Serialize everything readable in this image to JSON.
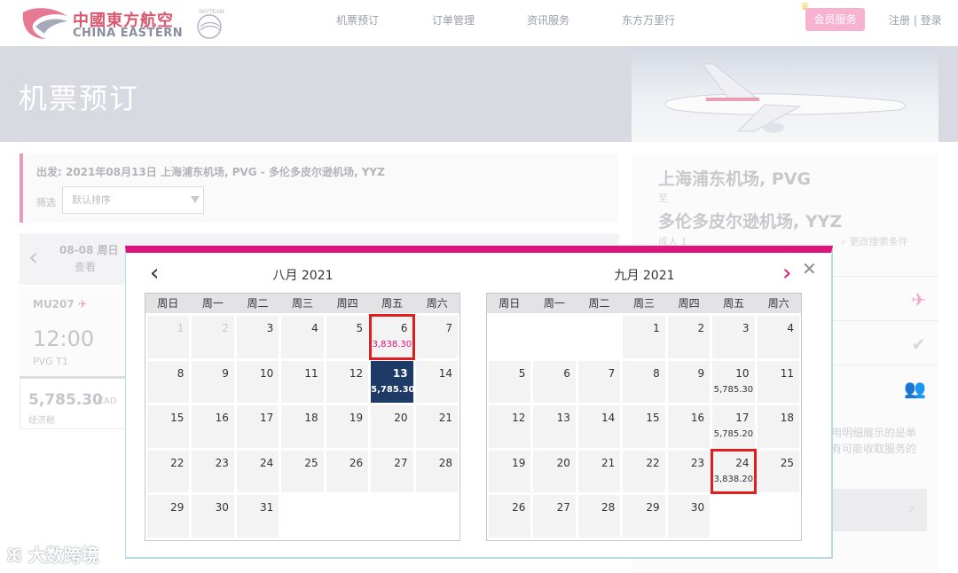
{
  "brand": {
    "cn": "中國東方航空",
    "en": "CHINA EASTERN",
    "alliance": "SKYTEAM"
  },
  "nav": {
    "items": [
      "机票预订",
      "订单管理",
      "资讯服务",
      "东方万里行"
    ],
    "member": "会员服务",
    "auth": "注册 | 登录"
  },
  "banner": {
    "title": "机票预订"
  },
  "search": {
    "departure": "出发: 2021年08月13日 上海浦东机场, PVG - 多伦多皮尔逊机场, YYZ",
    "filter_label": "筛选",
    "sort_value": "默认排序"
  },
  "date_strip": {
    "date": "08-08 周日",
    "view": "查看"
  },
  "flight": {
    "number": "MU207",
    "time": "12:00",
    "terminal": "PVG T1",
    "price": "5,785.30",
    "currency": "CAD",
    "cabin": "经济舱"
  },
  "side": {
    "from": "上海浦东机场, PVG",
    "to_label": "至",
    "to": "多伦多皮尔逊机场, YYZ",
    "passengers": "成人 1",
    "change": "更改搜索条件",
    "note_line1": "用明细展示的是单",
    "note_line2": "有可能收取服务的"
  },
  "calendar": {
    "weekdays": [
      "周日",
      "周一",
      "周二",
      "周三",
      "周四",
      "周五",
      "周六"
    ],
    "august": {
      "title": "八月 2021",
      "cells": [
        {
          "day": "1",
          "past": true
        },
        {
          "day": "2",
          "past": true
        },
        {
          "day": "3"
        },
        {
          "day": "4"
        },
        {
          "day": "5"
        },
        {
          "day": "6",
          "price": "3,838.30",
          "low": true,
          "highlight": true
        },
        {
          "day": "7"
        },
        {
          "day": "8"
        },
        {
          "day": "9"
        },
        {
          "day": "10"
        },
        {
          "day": "11"
        },
        {
          "day": "12"
        },
        {
          "day": "13",
          "price": "5,785.30",
          "selected": true
        },
        {
          "day": "14"
        },
        {
          "day": "15"
        },
        {
          "day": "16"
        },
        {
          "day": "17"
        },
        {
          "day": "18"
        },
        {
          "day": "19"
        },
        {
          "day": "20"
        },
        {
          "day": "21"
        },
        {
          "day": "22"
        },
        {
          "day": "23"
        },
        {
          "day": "24"
        },
        {
          "day": "25"
        },
        {
          "day": "26"
        },
        {
          "day": "27"
        },
        {
          "day": "28"
        },
        {
          "day": "29"
        },
        {
          "day": "30"
        },
        {
          "day": "31"
        }
      ]
    },
    "september": {
      "title": "九月 2021",
      "cells": [
        {
          "empty": true
        },
        {
          "empty": true
        },
        {
          "empty": true
        },
        {
          "day": "1"
        },
        {
          "day": "2"
        },
        {
          "day": "3"
        },
        {
          "day": "4"
        },
        {
          "day": "5"
        },
        {
          "day": "6"
        },
        {
          "day": "7"
        },
        {
          "day": "8"
        },
        {
          "day": "9"
        },
        {
          "day": "10",
          "price": "5,785.30"
        },
        {
          "day": "11"
        },
        {
          "day": "12"
        },
        {
          "day": "13"
        },
        {
          "day": "14"
        },
        {
          "day": "15"
        },
        {
          "day": "16"
        },
        {
          "day": "17",
          "price": "5,785.20"
        },
        {
          "day": "18"
        },
        {
          "day": "19"
        },
        {
          "day": "20"
        },
        {
          "day": "21"
        },
        {
          "day": "22"
        },
        {
          "day": "23"
        },
        {
          "day": "24",
          "price": "3,838.20",
          "highlight": true
        },
        {
          "day": "25"
        },
        {
          "day": "26"
        },
        {
          "day": "27"
        },
        {
          "day": "28"
        },
        {
          "day": "29"
        },
        {
          "day": "30"
        }
      ]
    }
  },
  "watermark": "大数跨境",
  "colors": {
    "accent": "#e0127b",
    "selected": "#1e3a66",
    "highlight_border": "#e21d1d",
    "member_button": "#f6b2cf"
  }
}
